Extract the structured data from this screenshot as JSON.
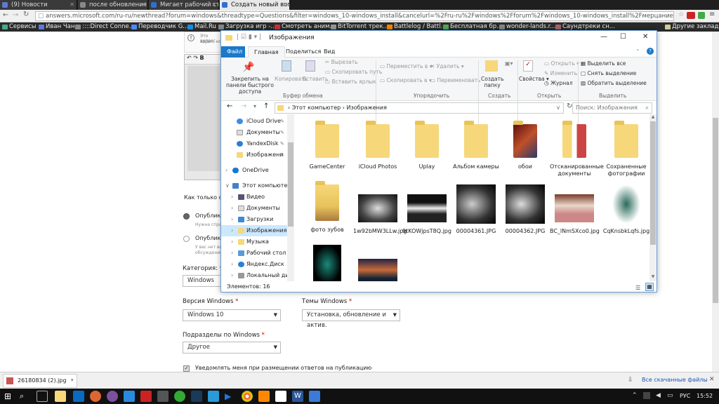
{
  "browser": {
    "tabs": [
      {
        "label": "(9) Новости",
        "color": "#5b7bd5",
        "active": false
      },
      {
        "label": "после обновления w",
        "color": "#888",
        "active": false
      },
      {
        "label": "Мигает рабочий ст",
        "color": "#2e6fd1",
        "active": false
      },
      {
        "label": "Создать новый вопр",
        "color": "#2e6fd1",
        "active": true
      }
    ],
    "url": "answers.microsoft.com/ru-ru/newthread?forum=windows&threadtype=Questions&filter=windows_10-windows_install&cancelurl=%2Fru-ru%2Fwindows%2Fforum%2Fwindows_10-windows_install%2Fмерцание%2F68a96711-1ecb-4339-8",
    "bookmarks": [
      "Сервисы",
      "Иван Чан",
      "::::Direct Conne...",
      "Переводчик G...",
      "Mail.Ru",
      "Загрузка игр -...",
      "Смотреть аним...",
      "BitTorrent трек...",
      "Battlelog / Battl...",
      "Бесплатная бр...",
      "wonder-lands.r...",
      "Саундтреки сн..."
    ],
    "other_bookmarks": "Другие закладки"
  },
  "form": {
    "hint1": "Это вопрос",
    "hint2": "адрес, но",
    "text_cut": "Как только отк",
    "opt1": "Опублико",
    "opt1_sub": "Нужна справ",
    "opt2": "Опублико",
    "opt2_sub1": "У вас нет воп",
    "opt2_sub2": "обсуждение",
    "category_label": "Категория:",
    "category_value": "Windows",
    "version_label": "Версия Windows",
    "version_value": "Windows 10",
    "topic_label": "Темы Windows",
    "topic_value": "Установка, обновление и актив.",
    "sub_label": "Подразделы по Windows",
    "sub_value": "Другое",
    "notify": "Уведомлять меня при размещении ответов на публикацию",
    "required_mark": "*"
  },
  "explorer": {
    "title": "Изображения",
    "ribbon_tabs": [
      "Файл",
      "Главная",
      "Поделиться",
      "Вид"
    ],
    "clipboard": {
      "pin": "Закрепить на панели быстрого доступа",
      "copy": "Копировать",
      "paste": "Вставить",
      "cut": "Вырезать",
      "copy_path": "Скопировать путь",
      "paste_shortcut": "Вставить ярлык",
      "group": "Буфер обмена"
    },
    "organize": {
      "move": "Переместить в",
      "copy_to": "Скопировать в",
      "delete": "Удалить",
      "rename": "Переименовать",
      "group": "Упорядочить"
    },
    "create": {
      "new_folder": "Создать папку",
      "group": "Создать"
    },
    "open": {
      "props": "Свойства",
      "open": "Открыть",
      "edit": "Изменить",
      "history": "Журнал",
      "group": "Открыть"
    },
    "select": {
      "all": "Выделить все",
      "none": "Снять выделение",
      "invert": "Обратить выделение",
      "group": "Выделить"
    },
    "breadcrumb": [
      "Этот компьютер",
      "Изображения"
    ],
    "search_placeholder": "Поиск: Изображения",
    "tree": [
      "iCloud Drive",
      "Документы",
      "YandexDisk",
      "Изображени",
      "OneDrive",
      "Этот компьютер",
      "Видео",
      "Документы",
      "Загрузки",
      "Изображения",
      "Музыка",
      "Рабочий стол",
      "Яндекс.Диск",
      "Локальный дис"
    ],
    "items": [
      {
        "name": "GameCenter",
        "kind": "folder"
      },
      {
        "name": "iCloud Photos",
        "kind": "folder"
      },
      {
        "name": "Uplay",
        "kind": "folder"
      },
      {
        "name": "Альбом камеры",
        "kind": "folder"
      },
      {
        "name": "обои",
        "kind": "folder-img"
      },
      {
        "name": "Отсканированные документы",
        "kind": "folder-img"
      },
      {
        "name": "Сохраненные фотографии",
        "kind": "folder"
      },
      {
        "name": "фото зубов",
        "kind": "folder-img"
      },
      {
        "name": "1w92bMW3LLw.jpg",
        "kind": "photo"
      },
      {
        "name": "9tKOWjpsT8Q.jpg",
        "kind": "photo"
      },
      {
        "name": "00004361.JPG",
        "kind": "xray"
      },
      {
        "name": "00004362.JPG",
        "kind": "xray"
      },
      {
        "name": "BC_lNmSXco0.jpg",
        "kind": "photo"
      },
      {
        "name": "CqKnsbkLqfs.jpg",
        "kind": "art"
      },
      {
        "name": "",
        "kind": "art2"
      },
      {
        "name": "",
        "kind": "sunset"
      }
    ],
    "status": "Элементов: 16"
  },
  "downloads": {
    "file": "26180834 (2).jpg",
    "show_all": "Все скачанные файлы"
  },
  "taskbar": {
    "lang": "РУС",
    "time": "15:52"
  }
}
